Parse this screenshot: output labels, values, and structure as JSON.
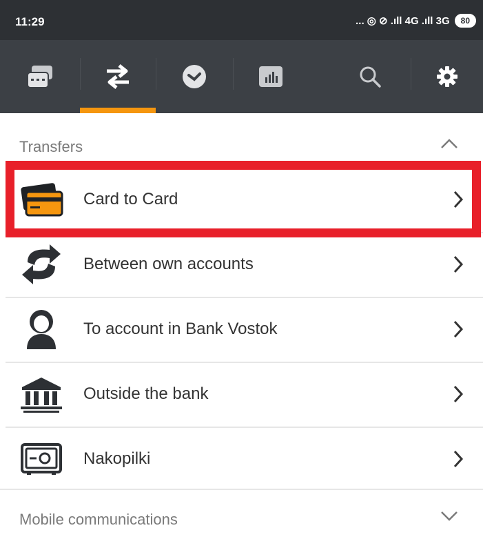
{
  "status_bar": {
    "time": "11:29",
    "indicators": "... ◎ ⊘ .ıll 4G .ıll 3G",
    "battery": "80"
  },
  "nav": {
    "tabs": [
      {
        "name": "messages",
        "icon": "chat-icon",
        "active": false
      },
      {
        "name": "transfers",
        "icon": "transfer-arrows-icon",
        "active": true
      },
      {
        "name": "history",
        "icon": "clock-icon",
        "active": false
      },
      {
        "name": "analytics",
        "icon": "chart-icon",
        "active": false
      },
      {
        "name": "search",
        "icon": "search-icon",
        "active": false
      },
      {
        "name": "settings",
        "icon": "gear-icon",
        "active": false
      }
    ],
    "accent": "#f5960f"
  },
  "sections": [
    {
      "title": "Transfers",
      "expanded": true,
      "items": [
        {
          "label": "Card to Card",
          "icon": "cards-icon",
          "highlighted": true
        },
        {
          "label": "Between own accounts",
          "icon": "exchange-arrows-icon"
        },
        {
          "label": "To account in Bank Vostok",
          "icon": "person-icon"
        },
        {
          "label": "Outside the bank",
          "icon": "bank-icon"
        },
        {
          "label": "Nakopilki",
          "icon": "safe-icon"
        }
      ]
    },
    {
      "title": "Mobile communications",
      "expanded": false,
      "items": []
    }
  ],
  "colors": {
    "highlight": "#e8202a",
    "nav_bg": "#3c4045",
    "status_bg": "#2d3034"
  }
}
